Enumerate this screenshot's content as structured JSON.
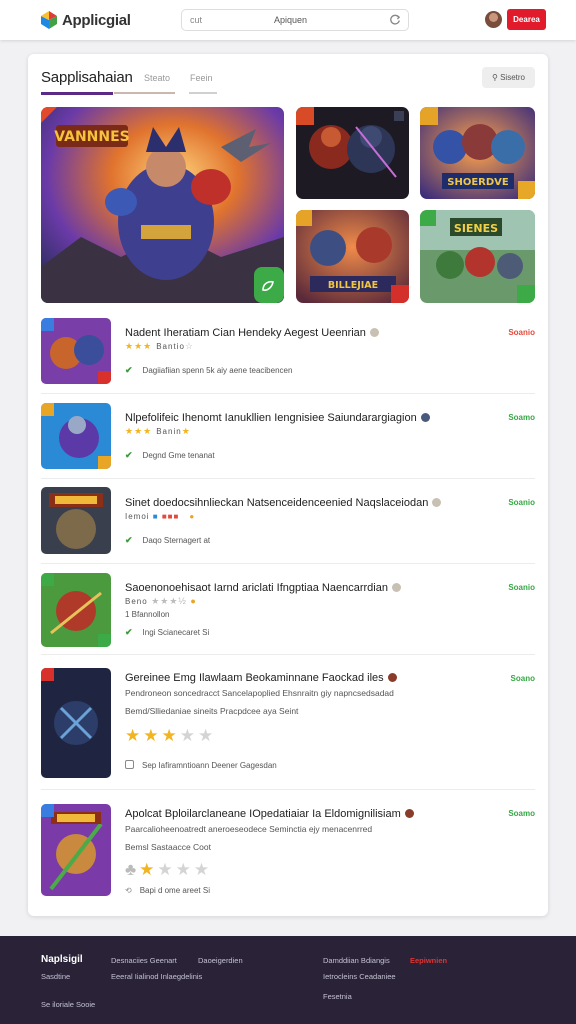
{
  "header": {
    "brand": "Applicgial",
    "search_left": "cut",
    "search_placeholder": "Apiquen",
    "signin_label": "Dearea",
    "colors": {
      "accent": "#e11b2b",
      "logo": [
        "#e53935",
        "#43a047",
        "#1e88e5"
      ]
    }
  },
  "card": {
    "title": "Sapplisahaian",
    "tabs": [
      "Steato",
      "Feein"
    ],
    "action_label": "Sisetro",
    "tab_colors": [
      "#5b2a86",
      "#c9b8ad",
      "#d0d0d0"
    ]
  },
  "hero": {
    "main_title": "VANNNES",
    "thumbs": [
      {
        "caption": "",
        "icon": "kiwi-icon"
      },
      {
        "caption": "SHOERDVE",
        "icon": "play-icon"
      },
      {
        "caption": "BILLEJIAE",
        "icon": "menu-icon"
      },
      {
        "caption": "SIENES",
        "icon": "leaf-icon"
      }
    ]
  },
  "list": [
    {
      "title": "Nadent Iheratiam Cian Hendeky Aegest Ueenrian",
      "action": "Soanio",
      "action_color": "#e24a3b",
      "rating": "Bantio",
      "meta": "Dagiiafiian spenn 5k aiy aene teacibencen"
    },
    {
      "title": "Nlpefolifeic Ihenomt Ianukllien Iengnisiee Saiundarargiagion",
      "action": "Soamo",
      "action_color": "#36a845",
      "rating": "Banin",
      "meta": "Degnd Gme tenanat"
    },
    {
      "title": "Sinet doedocsihnlieckan Natsenceidenceenied Naqslaceiodan",
      "action": "Soanio",
      "action_color": "#36a845",
      "rating": "Iemoi",
      "meta": "Daqo Sternagert at"
    },
    {
      "title": "Saoenonoehisaot Iarnd ariclati Ifngptiaa Naencarrdian",
      "action": "Soanio",
      "action_color": "#36a845",
      "rating": "Beno",
      "extra": "1  Bfannollon",
      "meta": "Ingi  Scianecaret Si"
    },
    {
      "title": "Gereinee Emg Ilawlaam Beokaminnane Faockad iles",
      "action": "Soano",
      "action_color": "#36a845",
      "sub": "Pendroneon soncedracct Sancelapoplied Ehsnraitn giy napncsedsadad",
      "sub2": "Bemd/Slliedaniae sineits Pracpdcee aya Seint",
      "meta": "Sep  Iafiramntioann  Deener  Gagesdan"
    },
    {
      "title": "Apolcat Bploilarclaneane IOpedatiaiar Ia Eldomignilisiam",
      "action": "Soamo",
      "action_color": "#36a845",
      "sub": "Paarcalioheenoatredt aneroeseodece Seminctia ejy menacenrred",
      "sub2": "Bemsl  Sastaacce Coot",
      "meta": "Bapi  d  ome  areet Si"
    }
  ],
  "footer": {
    "brand": "Naplsigil",
    "links": [
      "Sasdtine",
      "Desnaciies Geenart",
      "Daoeigerdien",
      "Eeeral Iialinod Inlaegdelinis",
      "Damddiian Bdiangis",
      "Eepiwnien",
      "Ietrocleins Ceadaniee",
      "Fesetnia",
      "Se iloriale Sooie"
    ]
  }
}
